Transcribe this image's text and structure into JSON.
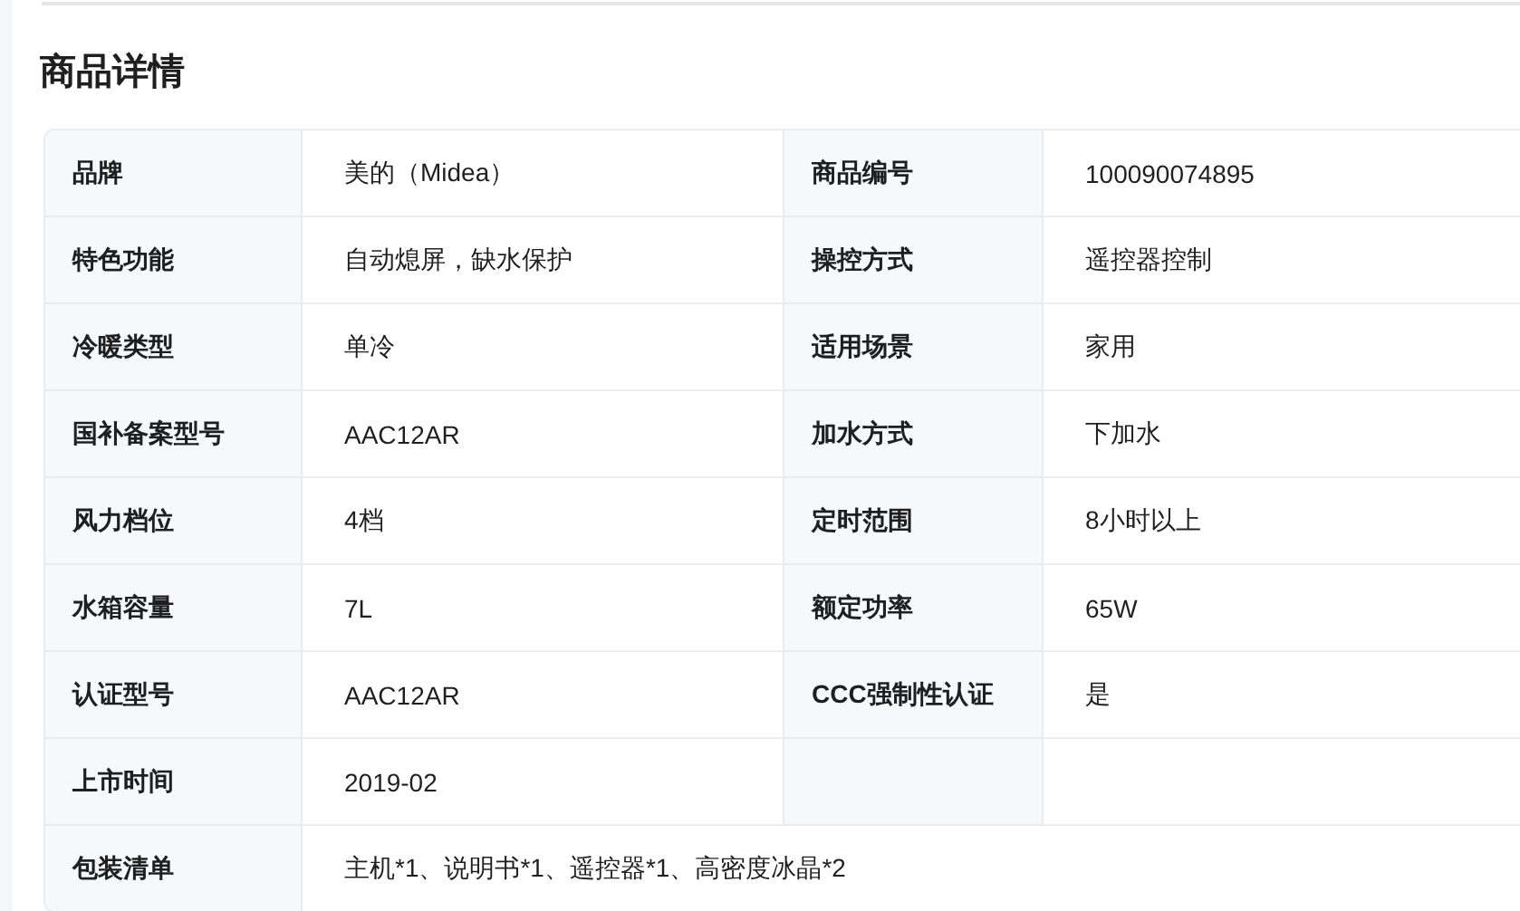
{
  "title": "商品详情",
  "rows": [
    {
      "kind": "pair",
      "cells": [
        {
          "label": "品牌",
          "value": "美的（Midea）"
        },
        {
          "label": "商品编号",
          "value": "100090074895"
        }
      ]
    },
    {
      "kind": "pair",
      "cells": [
        {
          "label": "特色功能",
          "value": "自动熄屏，缺水保护"
        },
        {
          "label": "操控方式",
          "value": "遥控器控制"
        }
      ]
    },
    {
      "kind": "pair",
      "cells": [
        {
          "label": "冷暖类型",
          "value": "单冷"
        },
        {
          "label": "适用场景",
          "value": "家用"
        }
      ]
    },
    {
      "kind": "pair",
      "cells": [
        {
          "label": "国补备案型号",
          "value": "AAC12AR"
        },
        {
          "label": "加水方式",
          "value": "下加水"
        }
      ]
    },
    {
      "kind": "pair",
      "cells": [
        {
          "label": "风力档位",
          "value": "4档"
        },
        {
          "label": "定时范围",
          "value": "8小时以上"
        }
      ]
    },
    {
      "kind": "pair",
      "cells": [
        {
          "label": "水箱容量",
          "value": "7L"
        },
        {
          "label": "额定功率",
          "value": "65W"
        }
      ]
    },
    {
      "kind": "pair",
      "cells": [
        {
          "label": "认证型号",
          "value": "AAC12AR"
        },
        {
          "label": "CCC强制性认证",
          "value": "是"
        }
      ]
    },
    {
      "kind": "pair",
      "cells": [
        {
          "label": "上市时间",
          "value": "2019-02"
        }
      ]
    },
    {
      "kind": "full",
      "cells": [
        {
          "label": "包装清单",
          "value": "主机*1、说明书*1、遥控器*1、高密度冰晶*2"
        }
      ]
    }
  ]
}
